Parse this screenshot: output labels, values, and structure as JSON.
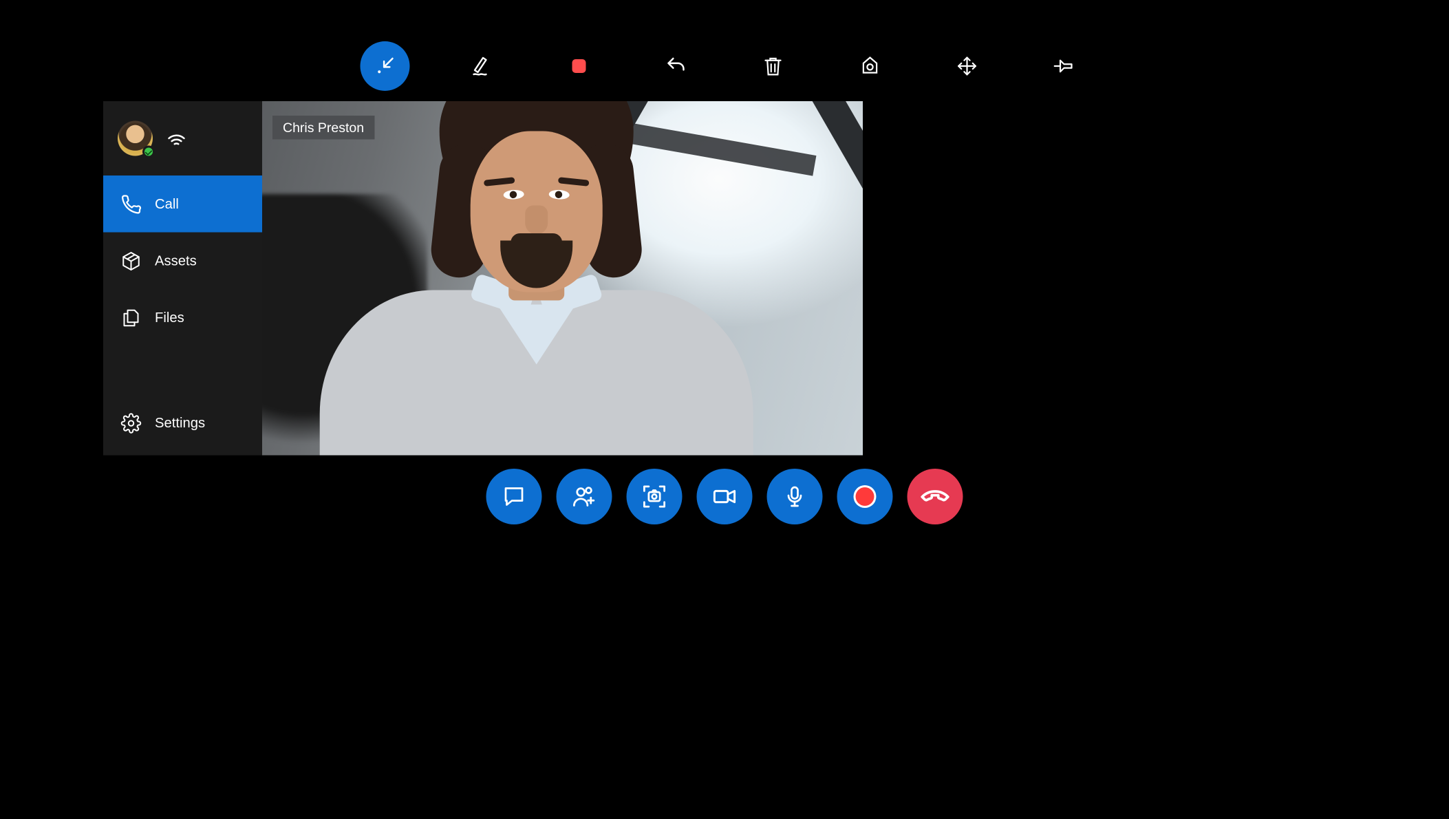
{
  "top_toolbar": {
    "icons": {
      "minimize": "minimize-icon",
      "ink": "ink-icon",
      "stop": "stop-icon",
      "undo": "undo-icon",
      "trash": "trash-icon",
      "locate": "locate-icon",
      "move": "move-icon",
      "pin": "pin-icon"
    }
  },
  "sidebar": {
    "presence": "available",
    "icons": {
      "signal": "wifi-icon"
    },
    "items": [
      {
        "label": "Call",
        "icon": "phone-icon",
        "selected": true
      },
      {
        "label": "Assets",
        "icon": "package-icon",
        "selected": false
      },
      {
        "label": "Files",
        "icon": "files-icon",
        "selected": false
      },
      {
        "label": "Settings",
        "icon": "gear-icon",
        "selected": false
      }
    ]
  },
  "video": {
    "remote_name": "Chris Preston"
  },
  "call_bar": {
    "icons": {
      "chat": "chat-icon",
      "add_participant": "add-person-icon",
      "snapshot": "snapshot-icon",
      "video": "video-icon",
      "mic": "mic-icon",
      "record": "record-icon",
      "end_call": "end-call-icon"
    }
  },
  "colors": {
    "accent": "#0d6fd1",
    "danger": "#e63a52",
    "record": "#ff3a3a"
  }
}
